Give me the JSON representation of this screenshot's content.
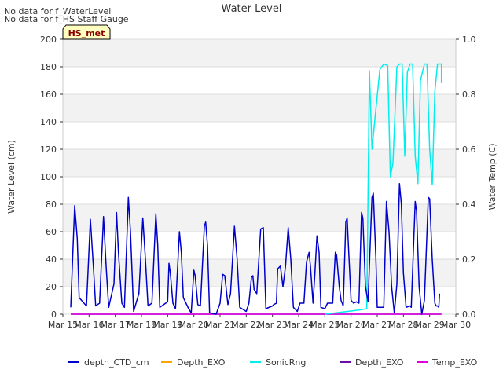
{
  "notes": [
    "No data for f_WaterLevel",
    "No data for f_HS Staff Gauge"
  ],
  "badge": "HS_met",
  "chart_data": {
    "type": "line",
    "title": "Water Level",
    "ylabel": "Water Level (cm)",
    "y2label": "Water Temp (C)",
    "x_ticks": [
      "Mar 15",
      "Mar 16",
      "Mar 17",
      "Mar 18",
      "Mar 19",
      "Mar 20",
      "Mar 21",
      "Mar 22",
      "Mar 23",
      "Mar 24",
      "Mar 25",
      "Mar 26",
      "Mar 27",
      "Mar 28",
      "Mar 29",
      "Mar 30"
    ],
    "xlim": [
      15,
      30
    ],
    "ylim": [
      0,
      200
    ],
    "y_ticks": [
      0,
      20,
      40,
      60,
      80,
      100,
      120,
      140,
      160,
      180,
      200
    ],
    "y2lim": [
      0,
      1.0
    ],
    "y2_ticks": [
      "0.0",
      "0.2",
      "0.4",
      "0.6",
      "0.8",
      "1.0"
    ],
    "grid": true,
    "legend_position": "bottom",
    "series": [
      {
        "name": "depth_CTD_cm",
        "color": "#0000cc",
        "axis": "left",
        "points": [
          [
            15.3,
            5
          ],
          [
            15.45,
            79
          ],
          [
            15.55,
            55
          ],
          [
            15.62,
            12
          ],
          [
            15.9,
            6
          ],
          [
            16.05,
            69
          ],
          [
            16.18,
            30
          ],
          [
            16.25,
            6
          ],
          [
            16.4,
            8
          ],
          [
            16.55,
            71
          ],
          [
            16.65,
            35
          ],
          [
            16.75,
            5
          ],
          [
            16.95,
            22
          ],
          [
            17.05,
            74
          ],
          [
            17.12,
            45
          ],
          [
            17.25,
            8
          ],
          [
            17.35,
            5
          ],
          [
            17.5,
            85
          ],
          [
            17.58,
            60
          ],
          [
            17.7,
            2
          ],
          [
            17.9,
            15
          ],
          [
            18.05,
            70
          ],
          [
            18.15,
            40
          ],
          [
            18.25,
            6
          ],
          [
            18.4,
            8
          ],
          [
            18.55,
            73
          ],
          [
            18.62,
            50
          ],
          [
            18.7,
            5
          ],
          [
            19.0,
            9
          ],
          [
            19.05,
            37
          ],
          [
            19.1,
            30
          ],
          [
            19.2,
            8
          ],
          [
            19.3,
            4
          ],
          [
            19.45,
            60
          ],
          [
            19.52,
            45
          ],
          [
            19.6,
            12
          ],
          [
            19.8,
            4
          ],
          [
            19.9,
            1
          ],
          [
            20.0,
            32
          ],
          [
            20.05,
            28
          ],
          [
            20.15,
            7
          ],
          [
            20.25,
            6
          ],
          [
            20.4,
            64
          ],
          [
            20.45,
            67
          ],
          [
            20.52,
            50
          ],
          [
            20.6,
            1
          ],
          [
            20.85,
            0
          ],
          [
            21.0,
            8
          ],
          [
            21.1,
            29
          ],
          [
            21.18,
            28
          ],
          [
            21.3,
            7
          ],
          [
            21.4,
            15
          ],
          [
            21.55,
            64
          ],
          [
            21.65,
            40
          ],
          [
            21.75,
            5
          ],
          [
            22.0,
            2
          ],
          [
            22.1,
            8
          ],
          [
            22.2,
            27
          ],
          [
            22.25,
            28
          ],
          [
            22.3,
            18
          ],
          [
            22.4,
            15
          ],
          [
            22.55,
            62
          ],
          [
            22.65,
            63
          ],
          [
            22.75,
            4
          ],
          [
            23.0,
            6
          ],
          [
            23.05,
            7
          ],
          [
            23.15,
            8
          ],
          [
            23.2,
            33
          ],
          [
            23.3,
            35
          ],
          [
            23.4,
            20
          ],
          [
            23.5,
            35
          ],
          [
            23.6,
            63
          ],
          [
            23.7,
            40
          ],
          [
            23.8,
            5
          ],
          [
            23.95,
            2
          ],
          [
            24.05,
            8
          ],
          [
            24.2,
            8
          ],
          [
            24.3,
            38
          ],
          [
            24.4,
            45
          ],
          [
            24.45,
            35
          ],
          [
            24.55,
            8
          ],
          [
            24.62,
            30
          ],
          [
            24.7,
            57
          ],
          [
            24.78,
            45
          ],
          [
            24.85,
            5
          ],
          [
            25.0,
            4
          ],
          [
            25.1,
            8
          ],
          [
            25.3,
            8
          ],
          [
            25.4,
            45
          ],
          [
            25.45,
            43
          ],
          [
            25.55,
            20
          ],
          [
            25.62,
            10
          ],
          [
            25.7,
            6
          ],
          [
            25.8,
            67
          ],
          [
            25.85,
            70
          ],
          [
            25.9,
            50
          ],
          [
            26.0,
            10
          ],
          [
            26.1,
            8
          ],
          [
            26.2,
            9
          ],
          [
            26.3,
            8
          ],
          [
            26.4,
            74
          ],
          [
            26.45,
            70
          ],
          [
            26.55,
            20
          ],
          [
            26.65,
            9
          ],
          [
            26.8,
            85
          ],
          [
            26.85,
            88
          ],
          [
            26.95,
            40
          ],
          [
            27.0,
            5
          ],
          [
            27.15,
            5
          ],
          [
            27.25,
            5
          ],
          [
            27.35,
            82
          ],
          [
            27.45,
            60
          ],
          [
            27.55,
            20
          ],
          [
            27.65,
            1
          ],
          [
            27.75,
            22
          ],
          [
            27.85,
            95
          ],
          [
            27.92,
            80
          ],
          [
            28.0,
            30
          ],
          [
            28.1,
            5
          ],
          [
            28.25,
            6
          ],
          [
            28.3,
            5
          ],
          [
            28.45,
            82
          ],
          [
            28.5,
            75
          ],
          [
            28.6,
            20
          ],
          [
            28.7,
            0
          ],
          [
            28.8,
            10
          ],
          [
            28.95,
            85
          ],
          [
            29.0,
            84
          ],
          [
            29.1,
            40
          ],
          [
            29.2,
            8
          ],
          [
            29.25,
            6
          ],
          [
            29.3,
            6
          ],
          [
            29.35,
            5
          ],
          [
            29.38,
            15
          ]
        ]
      },
      {
        "name": "Depth_EXO",
        "color": "#ffa500",
        "axis": "left",
        "points": []
      },
      {
        "name": "SonicRng",
        "color": "#00eeee",
        "axis": "left",
        "points": [
          [
            25.0,
            0
          ],
          [
            26.3,
            3
          ],
          [
            26.6,
            4
          ],
          [
            26.7,
            177
          ],
          [
            26.8,
            120
          ],
          [
            26.9,
            140
          ],
          [
            27.1,
            178
          ],
          [
            27.25,
            182
          ],
          [
            27.4,
            181
          ],
          [
            27.5,
            100
          ],
          [
            27.6,
            110
          ],
          [
            27.75,
            180
          ],
          [
            27.85,
            182
          ],
          [
            27.95,
            182
          ],
          [
            28.05,
            115
          ],
          [
            28.15,
            176
          ],
          [
            28.25,
            182
          ],
          [
            28.35,
            182
          ],
          [
            28.45,
            115
          ],
          [
            28.55,
            95
          ],
          [
            28.65,
            170
          ],
          [
            28.8,
            182
          ],
          [
            28.9,
            182
          ],
          [
            29.0,
            120
          ],
          [
            29.1,
            94
          ],
          [
            29.2,
            162
          ],
          [
            29.3,
            182
          ],
          [
            29.45,
            182
          ],
          [
            29.45,
            168
          ]
        ]
      },
      {
        "name": "Depth_EXO",
        "color": "#6a0dad",
        "axis": "left",
        "points": [
          [
            15.3,
            0
          ],
          [
            29.45,
            0
          ]
        ]
      },
      {
        "name": "Temp_EXO",
        "color": "#dd00dd",
        "axis": "right",
        "points": [
          [
            15.3,
            0
          ],
          [
            29.45,
            0
          ]
        ]
      }
    ]
  }
}
